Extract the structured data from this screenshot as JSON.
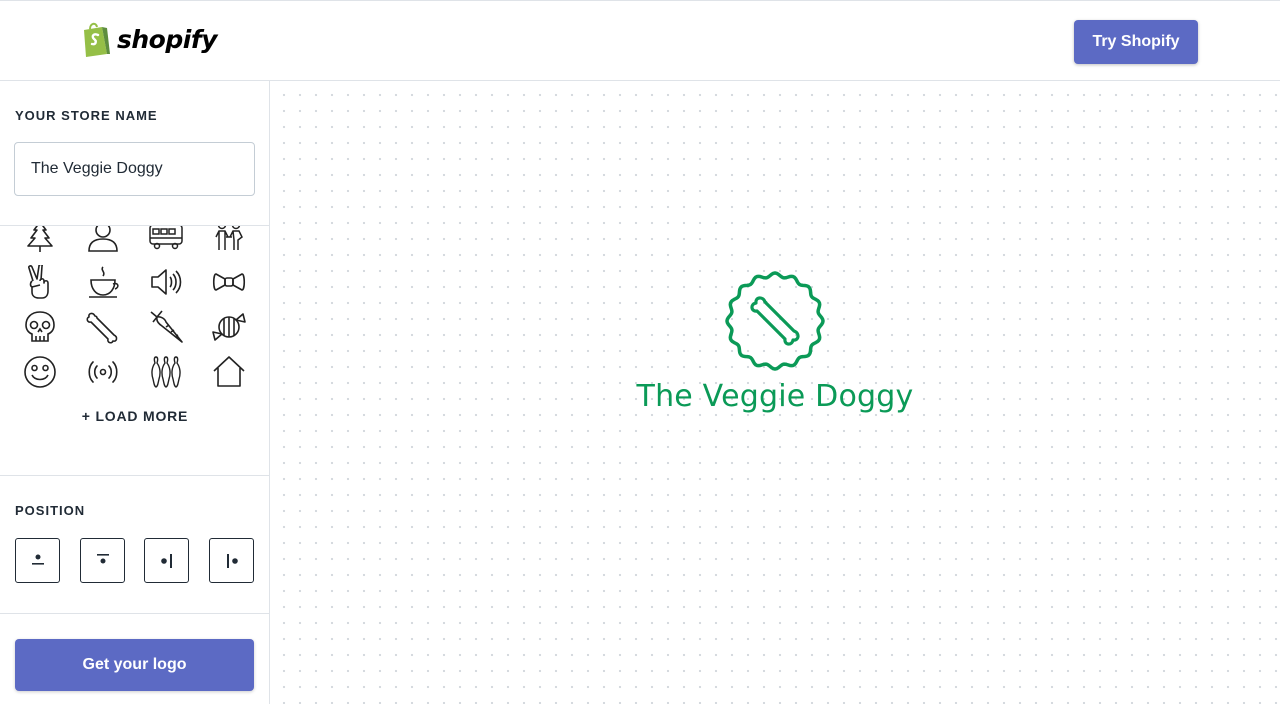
{
  "header": {
    "brand": "shopify",
    "cta_label": "Try Shopify"
  },
  "sidebar": {
    "store_name_label": "YOUR STORE NAME",
    "store_name_value": "The Veggie Doggy",
    "icons": [
      "tree-icon",
      "person-icon",
      "bus-icon",
      "family-icon",
      "peace-hand-icon",
      "coffee-cup-icon",
      "speaker-icon",
      "bow-tie-icon",
      "skull-icon",
      "bone-icon",
      "carrot-icon",
      "candy-icon",
      "smiley-icon",
      "broadcast-icon",
      "bowling-icon",
      "house-icon"
    ],
    "load_more_label": "+ LOAD MORE",
    "position_label": "POSITION",
    "position_options": [
      "icon-top-center",
      "icon-top-center-alt",
      "icon-left",
      "icon-right"
    ],
    "get_logo_label": "Get your logo"
  },
  "preview": {
    "store_name": "The Veggie Doggy",
    "icon": "bone-icon",
    "color": "#0b9a57"
  },
  "colors": {
    "accent": "#5c6ac4",
    "logo_green": "#0b9a57",
    "shopify_green": "#95bf47"
  }
}
